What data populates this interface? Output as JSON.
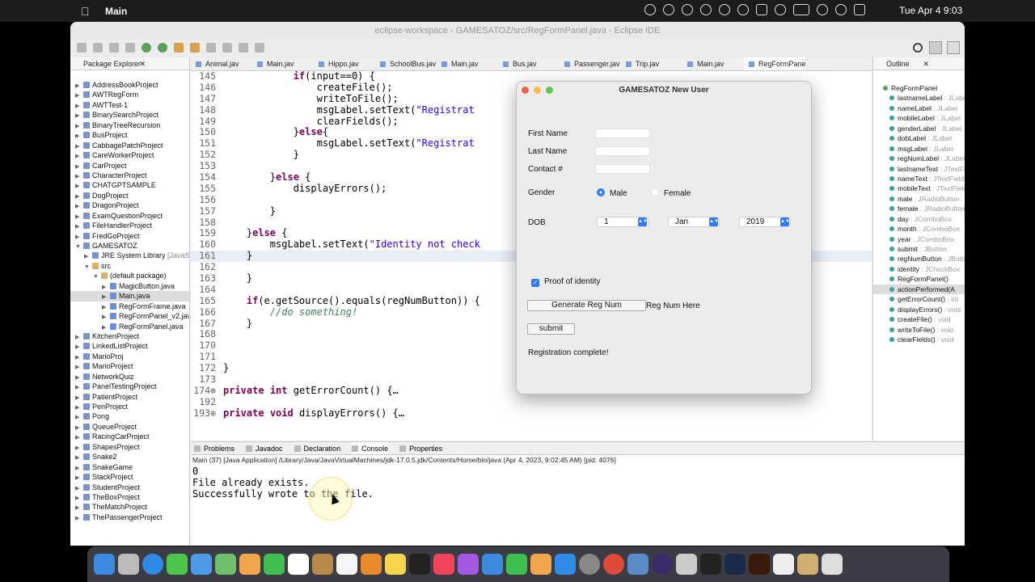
{
  "menubar": {
    "app_name": "Main",
    "clock": "Tue Apr 4  9:03"
  },
  "window": {
    "title": "eclipse-workspace - GAMESATOZ/src/RegFormPanel.java - Eclipse IDE"
  },
  "package_explorer": {
    "title": "Package Explorer",
    "items": [
      {
        "label": "AddressBookProject",
        "indent": 0,
        "kind": "project"
      },
      {
        "label": "AWTRegForm",
        "indent": 0,
        "kind": "project"
      },
      {
        "label": "AWTTest-1",
        "indent": 0,
        "kind": "project"
      },
      {
        "label": "BinarySearchProject",
        "indent": 0,
        "kind": "project"
      },
      {
        "label": "BinaryTreeRecursion",
        "indent": 0,
        "kind": "project"
      },
      {
        "label": "BusProject",
        "indent": 0,
        "kind": "project"
      },
      {
        "label": "CabbagePatchProject",
        "indent": 0,
        "kind": "project"
      },
      {
        "label": "CareWorkerProject",
        "indent": 0,
        "kind": "project"
      },
      {
        "label": "CarProject",
        "indent": 0,
        "kind": "project"
      },
      {
        "label": "CharacterProject",
        "indent": 0,
        "kind": "project"
      },
      {
        "label": "CHATGPTSAMPLE",
        "indent": 0,
        "kind": "project"
      },
      {
        "label": "DogProject",
        "indent": 0,
        "kind": "project"
      },
      {
        "label": "DragonProject",
        "indent": 0,
        "kind": "project"
      },
      {
        "label": "ExamQuestionProject",
        "indent": 0,
        "kind": "project"
      },
      {
        "label": "FileHandlerProject",
        "indent": 0,
        "kind": "project"
      },
      {
        "label": "FredGoProject",
        "indent": 0,
        "kind": "project"
      },
      {
        "label": "GAMESATOZ",
        "indent": 0,
        "kind": "project",
        "open": true
      },
      {
        "label": "JRE System Library",
        "suffix": " [JavaSE",
        "indent": 1,
        "kind": "lib"
      },
      {
        "label": "src",
        "indent": 1,
        "kind": "folder",
        "open": true
      },
      {
        "label": "(default package)",
        "indent": 2,
        "kind": "folder",
        "open": true
      },
      {
        "label": "MagicButton.java",
        "indent": 3,
        "kind": "java"
      },
      {
        "label": "Main.java",
        "indent": 3,
        "kind": "java",
        "selected": true
      },
      {
        "label": "RegFormFrame.java",
        "indent": 3,
        "kind": "java"
      },
      {
        "label": "RegFormPanel_v2.jav",
        "indent": 3,
        "kind": "java"
      },
      {
        "label": "RegFormPanel.java",
        "indent": 3,
        "kind": "java"
      },
      {
        "label": "KitchenProject",
        "indent": 0,
        "kind": "project"
      },
      {
        "label": "LinkedListProject",
        "indent": 0,
        "kind": "project"
      },
      {
        "label": "MarioProj",
        "indent": 0,
        "kind": "project"
      },
      {
        "label": "MarioProject",
        "indent": 0,
        "kind": "project"
      },
      {
        "label": "NetworkQuiz",
        "indent": 0,
        "kind": "project"
      },
      {
        "label": "PanelTestingProject",
        "indent": 0,
        "kind": "project"
      },
      {
        "label": "PatientProject",
        "indent": 0,
        "kind": "project"
      },
      {
        "label": "PenProject",
        "indent": 0,
        "kind": "project"
      },
      {
        "label": "Pong",
        "indent": 0,
        "kind": "project"
      },
      {
        "label": "QueueProject",
        "indent": 0,
        "kind": "project"
      },
      {
        "label": "RacingCarProject",
        "indent": 0,
        "kind": "project"
      },
      {
        "label": "ShapesProject",
        "indent": 0,
        "kind": "project"
      },
      {
        "label": "Snake2",
        "indent": 0,
        "kind": "project"
      },
      {
        "label": "SnakeGame",
        "indent": 0,
        "kind": "project"
      },
      {
        "label": "StackProject",
        "indent": 0,
        "kind": "project"
      },
      {
        "label": "StudentProject",
        "indent": 0,
        "kind": "project"
      },
      {
        "label": "TheBoxProject",
        "indent": 0,
        "kind": "project"
      },
      {
        "label": "TheMatchProject",
        "indent": 0,
        "kind": "project"
      },
      {
        "label": "ThePassengerProject",
        "indent": 0,
        "kind": "project"
      }
    ]
  },
  "editor": {
    "tabs": [
      "Animal.jav",
      "Main.jav",
      "Hippo.jav",
      "SchoolBus.jav",
      "Main.jav",
      "Bus.jav",
      "Passenger.jav",
      "Trip.jav",
      "Main.jav",
      "RegFormPanel.j"
    ],
    "active_tab": 9,
    "lines": [
      {
        "n": "145",
        "code": "            if(input==0) {"
      },
      {
        "n": "146",
        "code": "                createFile();"
      },
      {
        "n": "147",
        "code": "                writeToFile();"
      },
      {
        "n": "148",
        "code": "                msgLabel.setText(\"Registrat"
      },
      {
        "n": "149",
        "code": "                clearFields();"
      },
      {
        "n": "150",
        "code": "            }else{"
      },
      {
        "n": "151",
        "code": "                msgLabel.setText(\"Registrat"
      },
      {
        "n": "152",
        "code": "            }"
      },
      {
        "n": "153",
        "code": ""
      },
      {
        "n": "154",
        "code": "        }else {"
      },
      {
        "n": "155",
        "code": "            displayErrors();"
      },
      {
        "n": "156",
        "code": ""
      },
      {
        "n": "157",
        "code": "        }"
      },
      {
        "n": "158",
        "code": ""
      },
      {
        "n": "159",
        "code": "    }else {"
      },
      {
        "n": "160",
        "code": "        msgLabel.setText(\"Identity not check"
      },
      {
        "n": "161",
        "code": "    }",
        "highlight": true
      },
      {
        "n": "162",
        "code": ""
      },
      {
        "n": "163",
        "code": "    }"
      },
      {
        "n": "164",
        "code": ""
      },
      {
        "n": "165",
        "code": "    if(e.getSource().equals(regNumButton)) {"
      },
      {
        "n": "166",
        "code": "        //do something!"
      },
      {
        "n": "167",
        "code": "    }"
      },
      {
        "n": "168",
        "code": ""
      },
      {
        "n": "170",
        "code": ""
      },
      {
        "n": "171",
        "code": ""
      },
      {
        "n": "172",
        "code": "}"
      },
      {
        "n": "173",
        "code": ""
      },
      {
        "n": "174⊕",
        "code": "private int getErrorCount() {…"
      },
      {
        "n": "192",
        "code": ""
      },
      {
        "n": "193⊕",
        "code": "private void displayErrors() {…"
      }
    ]
  },
  "outline": {
    "title": "Outline",
    "items": [
      {
        "label": "RegFormPanel",
        "type": "",
        "root": true
      },
      {
        "label": "lastnameLabel",
        "type": " : JLabel"
      },
      {
        "label": "nameLabel",
        "type": " : JLabel"
      },
      {
        "label": "mobileLabel",
        "type": " : JLabel"
      },
      {
        "label": "genderLabel",
        "type": " : JLabel"
      },
      {
        "label": "dobLabel",
        "type": " : JLabel"
      },
      {
        "label": "msgLabel",
        "type": " : JLabel"
      },
      {
        "label": "regNumLabel",
        "type": " : JLabel"
      },
      {
        "label": "lastnameText",
        "type": " : JTextField"
      },
      {
        "label": "nameText",
        "type": " : JTextField"
      },
      {
        "label": "mobileText",
        "type": " : JTextField"
      },
      {
        "label": "male",
        "type": " : JRadioButton"
      },
      {
        "label": "female",
        "type": " : JRadioButton"
      },
      {
        "label": "day",
        "type": " : JComboBox"
      },
      {
        "label": "month",
        "type": " : JComboBox"
      },
      {
        "label": "year",
        "type": " : JComboBox"
      },
      {
        "label": "submit",
        "type": " : JButton"
      },
      {
        "label": "regNumButton",
        "type": " : JButton"
      },
      {
        "label": "identity",
        "type": " : JCheckBox"
      },
      {
        "label": "RegFormPanel()",
        "type": ""
      },
      {
        "label": "actionPerformed(A",
        "type": "",
        "selected": true
      },
      {
        "label": "getErrorCount()",
        "type": " : int"
      },
      {
        "label": "displayErrors()",
        "type": " : void"
      },
      {
        "label": "createFile()",
        "type": " : void"
      },
      {
        "label": "writeToFile()",
        "type": " : void"
      },
      {
        "label": "clearFields()",
        "type": " : void"
      }
    ]
  },
  "console": {
    "tabs": [
      "Problems",
      "Javadoc",
      "Declaration",
      "Console",
      "Properties"
    ],
    "active_tab": 3,
    "header": "Main (37) [Java Application] /Library/Java/JavaVirtualMachines/jdk-17.0.5.jdk/Contents/Home/bin/java  (Apr 4, 2023, 9:02:45 AM) [pid: 4076]",
    "output": [
      "0",
      "File already exists.",
      "Successfully wrote to the file."
    ]
  },
  "dialog": {
    "title": "GAMESATOZ New User",
    "first_name_label": "First Name",
    "last_name_label": "Last Name",
    "contact_label": "Contact #",
    "gender_label": "Gender",
    "male_label": "Male",
    "female_label": "Female",
    "male_selected": true,
    "dob_label": "DOB",
    "day_value": "1",
    "month_value": "Jan",
    "year_value": "2019",
    "proof_label": "Proof of identity",
    "proof_checked": true,
    "generate_button": "Generate Reg Num",
    "reg_num_label": "Reg Num Here",
    "submit_button": "submit",
    "message": "Registration complete!"
  },
  "colors": {
    "accent": "#2d7cf6",
    "keyword": "#7f0055",
    "string": "#2a00ff",
    "comment": "#3f7f5f"
  }
}
